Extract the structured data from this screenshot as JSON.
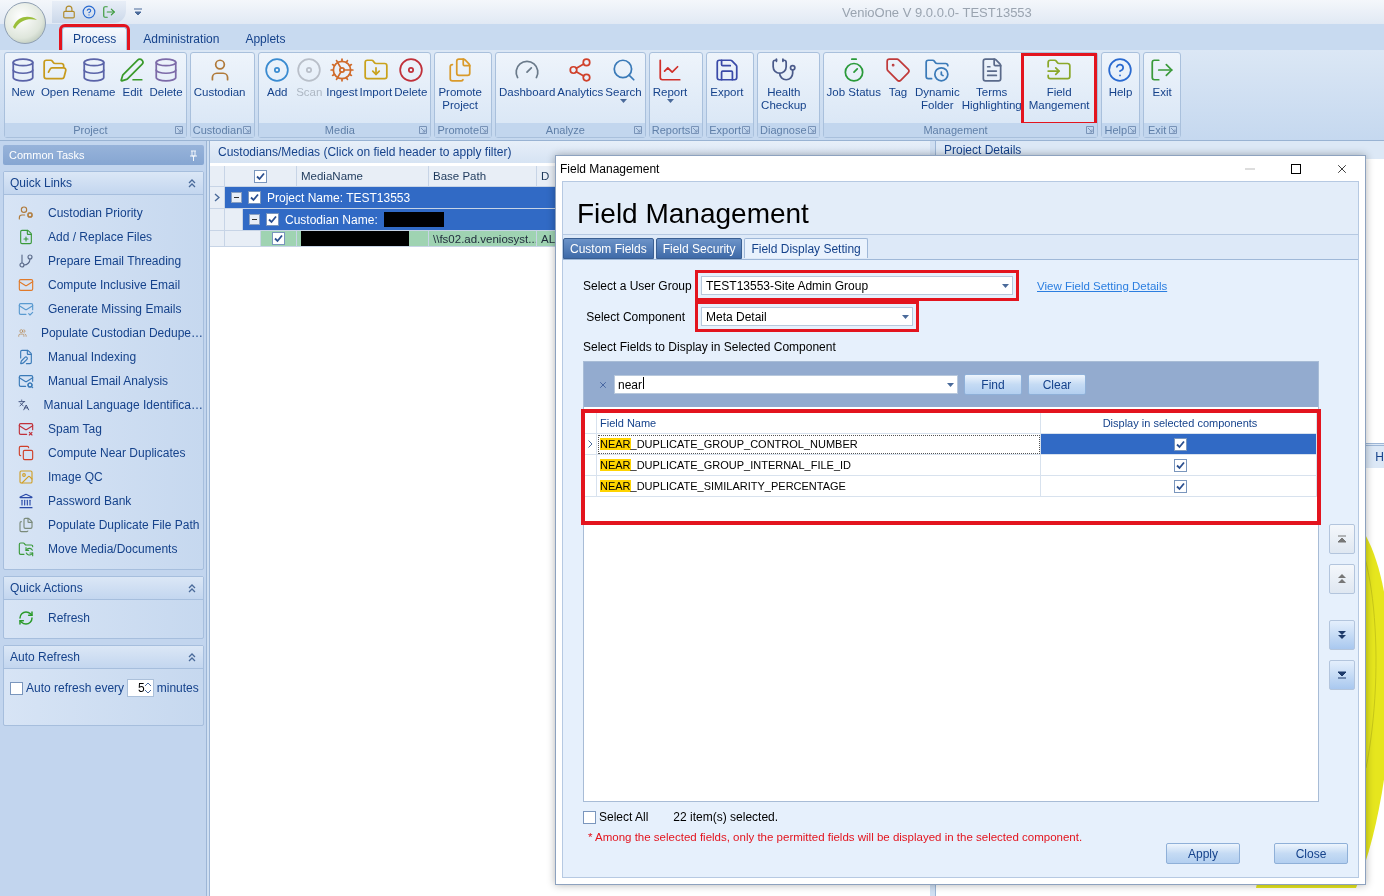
{
  "title_bar": {
    "title": "VenioOne V 9.0.0.0- TEST13553"
  },
  "menu_tabs": [
    {
      "label": "Process",
      "selected": true,
      "highlighted": true
    },
    {
      "label": "Administration",
      "selected": false,
      "highlighted": false
    },
    {
      "label": "Applets",
      "selected": false,
      "highlighted": false
    }
  ],
  "ribbon": [
    {
      "label": "Project",
      "buttons": [
        {
          "label": "New",
          "disabled": false,
          "dropdown": false,
          "highlighted": false
        },
        {
          "label": "Open",
          "disabled": false,
          "dropdown": false,
          "highlighted": false
        },
        {
          "label": "Rename",
          "disabled": false,
          "dropdown": false,
          "highlighted": false
        },
        {
          "label": "Edit",
          "disabled": false,
          "dropdown": false,
          "highlighted": false
        },
        {
          "label": "Delete",
          "disabled": false,
          "dropdown": false,
          "highlighted": false
        }
      ]
    },
    {
      "label": "Custodian",
      "buttons": [
        {
          "label": "Custodian",
          "disabled": false,
          "dropdown": false,
          "highlighted": false
        }
      ]
    },
    {
      "label": "Media",
      "buttons": [
        {
          "label": "Add",
          "disabled": false,
          "dropdown": false,
          "highlighted": false
        },
        {
          "label": "Scan",
          "disabled": true,
          "dropdown": false,
          "highlighted": false
        },
        {
          "label": "Ingest",
          "disabled": false,
          "dropdown": false,
          "highlighted": false
        },
        {
          "label": "Import",
          "disabled": false,
          "dropdown": false,
          "highlighted": false
        },
        {
          "label": "Delete",
          "disabled": false,
          "dropdown": false,
          "highlighted": false
        }
      ]
    },
    {
      "label": "Promote",
      "buttons": [
        {
          "label": "Promote\nProject",
          "disabled": false,
          "dropdown": false,
          "highlighted": false
        }
      ]
    },
    {
      "label": "Analyze",
      "buttons": [
        {
          "label": "Dashboard",
          "disabled": false,
          "dropdown": false,
          "highlighted": false
        },
        {
          "label": "Analytics",
          "disabled": false,
          "dropdown": false,
          "highlighted": false
        },
        {
          "label": "Search",
          "disabled": false,
          "dropdown": true,
          "highlighted": false
        }
      ]
    },
    {
      "label": "Reports",
      "buttons": [
        {
          "label": "Report",
          "disabled": false,
          "dropdown": true,
          "highlighted": false
        }
      ]
    },
    {
      "label": "Export",
      "buttons": [
        {
          "label": "Export",
          "disabled": false,
          "dropdown": false,
          "highlighted": false
        }
      ]
    },
    {
      "label": "Diagnose",
      "buttons": [
        {
          "label": "Health\nCheckup",
          "disabled": false,
          "dropdown": false,
          "highlighted": false
        }
      ]
    },
    {
      "label": "Management",
      "buttons": [
        {
          "label": "Job Status",
          "disabled": false,
          "dropdown": false,
          "highlighted": false
        },
        {
          "label": "Tag",
          "disabled": false,
          "dropdown": false,
          "highlighted": false
        },
        {
          "label": "Dynamic\nFolder",
          "disabled": false,
          "dropdown": false,
          "highlighted": false
        },
        {
          "label": "Terms\nHighlighting",
          "disabled": false,
          "dropdown": false,
          "highlighted": false
        },
        {
          "label": "Field\nMangement",
          "disabled": false,
          "dropdown": false,
          "highlighted": true
        }
      ]
    },
    {
      "label": "Help",
      "buttons": [
        {
          "label": "Help",
          "disabled": false,
          "dropdown": false,
          "highlighted": false
        }
      ]
    },
    {
      "label": "Exit",
      "buttons": [
        {
          "label": "Exit",
          "disabled": false,
          "dropdown": false,
          "highlighted": false
        }
      ]
    }
  ],
  "sidebar": {
    "title": "Common Tasks",
    "quick_links": {
      "title": "Quick Links",
      "items": [
        "Custodian Priority",
        "Add / Replace Files",
        "Prepare Email Threading",
        "Compute Inclusive Email",
        "Generate Missing Emails",
        "Populate Custodian Dedupe…",
        "Manual Indexing",
        "Manual Email Analysis",
        "Manual Language Identifica…",
        "Spam Tag",
        "Compute Near Duplicates",
        "Image QC",
        "Password Bank",
        "Populate Duplicate File Path",
        "Move Media/Documents"
      ]
    },
    "quick_actions": {
      "title": "Quick Actions",
      "items": [
        "Refresh"
      ]
    },
    "auto_refresh": {
      "title": "Auto Refresh",
      "label": "Auto refresh every",
      "checked": false,
      "value": "5",
      "suffix": "minutes"
    }
  },
  "media_grid": {
    "title": "Custodians/Medias (Click on field header to apply filter)",
    "header_checked": true,
    "columns": [
      "MediaName",
      "Base Path",
      "D"
    ],
    "project_row": {
      "label": "Project Name: TEST13553",
      "checked": true,
      "expanded": true
    },
    "custodian_row": {
      "label": "Custodian Name:",
      "checked": true,
      "expanded": true
    },
    "media_row": {
      "checked": true,
      "base_path": "\\\\fs02.ad.veniosyst...",
      "column_3": "AL"
    }
  },
  "right_panel": {
    "title": "Project Details",
    "lower_tab": "H"
  },
  "dialog": {
    "window_title": "Field Management",
    "heading": "Field Management",
    "tabs": [
      {
        "label": "Custom Fields",
        "selected": false
      },
      {
        "label": "Field Security",
        "selected": false
      },
      {
        "label": "Field Display Setting",
        "selected": true
      }
    ],
    "user_group": {
      "label": "Select a User Group",
      "value": "TEST13553-Site Admin Group",
      "highlighted": true
    },
    "link": "View Field Setting Details",
    "component": {
      "label": "Select Component",
      "value": "Meta Detail",
      "highlighted": true
    },
    "section_label": "Select Fields to Display in Selected Component",
    "search": {
      "value": "near",
      "find": "Find",
      "clear": "Clear"
    },
    "grid": {
      "highlighted": true,
      "columns": [
        "Field Name",
        "Display in selected components"
      ],
      "rows": [
        {
          "match": "NEAR",
          "rest": "_DUPLICATE_GROUP_CONTROL_NUMBER",
          "checked": true,
          "selected": true
        },
        {
          "match": "NEAR",
          "rest": "_DUPLICATE_GROUP_INTERNAL_FILE_ID",
          "checked": true,
          "selected": false
        },
        {
          "match": "NEAR",
          "rest": "_DUPLICATE_SIMILARITY_PERCENTAGE",
          "checked": true,
          "selected": false
        }
      ]
    },
    "select_all": {
      "label": "Select All",
      "checked": false
    },
    "count": "22 item(s) selected.",
    "note": "* Among the selected fields, only the permitted fields will be displayed in the selected component.",
    "buttons": [
      "Apply",
      "Close"
    ]
  }
}
